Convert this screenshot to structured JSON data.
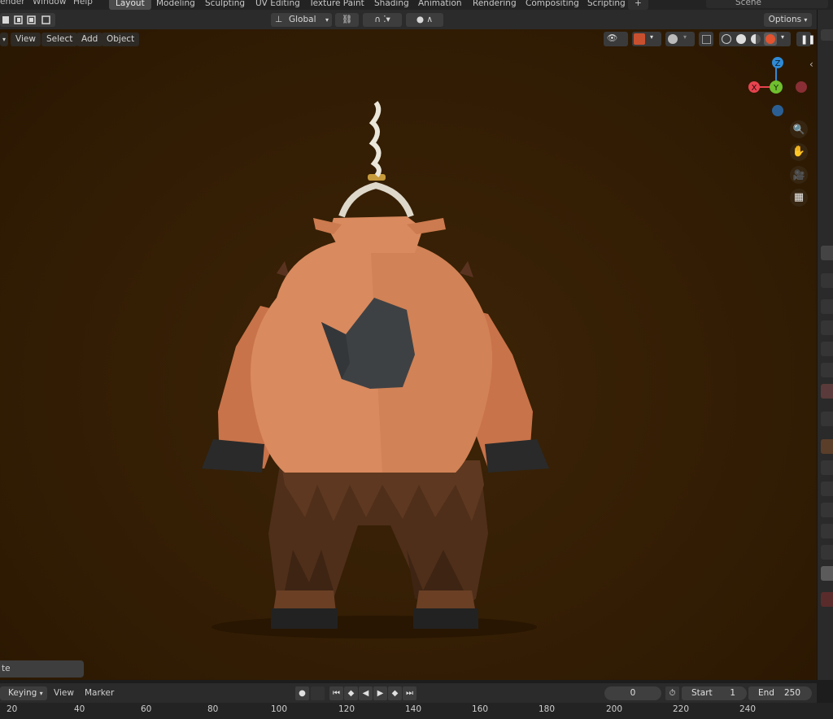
{
  "topbar": {
    "menus": [
      "ender",
      "Window",
      "Help"
    ],
    "workspaces": [
      "Layout",
      "Modeling",
      "Sculpting",
      "UV Editing",
      "Texture Paint",
      "Shading",
      "Animation",
      "Rendering",
      "Compositing",
      "Scripting"
    ],
    "active_workspace": "Layout",
    "add_tab": "+",
    "scene_label": "Scene"
  },
  "header": {
    "orientation": "Global",
    "options": "Options"
  },
  "viewport_menu": {
    "view": "View",
    "select": "Select",
    "add": "Add",
    "object": "Object"
  },
  "gizmo": {
    "z": "Z",
    "y": "Y",
    "x": "X"
  },
  "operator_panel": {
    "label": "te"
  },
  "timeline": {
    "keying": "Keying",
    "view": "View",
    "marker": "Marker",
    "current_frame": "0",
    "start_label": "Start",
    "start_value": "1",
    "end_label": "End",
    "end_value": "250",
    "ticks": [
      "20",
      "40",
      "60",
      "80",
      "100",
      "120",
      "140",
      "160",
      "180",
      "200",
      "220",
      "240"
    ]
  },
  "colors": {
    "viewport_bg": "#331d04",
    "skin": "#d98a5e",
    "rock": "#3e4144",
    "fur": "#4f2f1a",
    "horn": "#e8e2d5",
    "gizmo_x": "#e8434f",
    "gizmo_y": "#6fbf2e",
    "gizmo_z": "#2f8ad6"
  }
}
